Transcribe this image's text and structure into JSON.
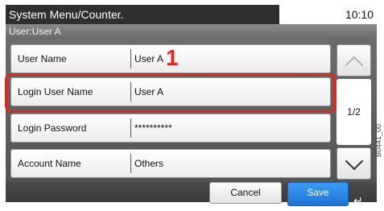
{
  "header": {
    "title": "System Menu/Counter.",
    "time": "10:10",
    "subtitle": "User:User A"
  },
  "rows": [
    {
      "label": "User Name",
      "value": "User A"
    },
    {
      "label": "Login User Name",
      "value": "User A"
    },
    {
      "label": "Login Password",
      "value": "**********"
    },
    {
      "label": "Account Name",
      "value": "Others"
    }
  ],
  "callout_number": "1",
  "page_indicator": "1/2",
  "buttons": {
    "cancel_label": "Cancel",
    "save_label": "Save"
  },
  "watermark": "B0441_00",
  "icons": {
    "scroll_up": "chevron-up-icon",
    "scroll_down": "chevron-down-icon",
    "enter": "enter-icon"
  },
  "colors": {
    "highlight": "#e3261d",
    "save_button": "#1f73d6"
  }
}
